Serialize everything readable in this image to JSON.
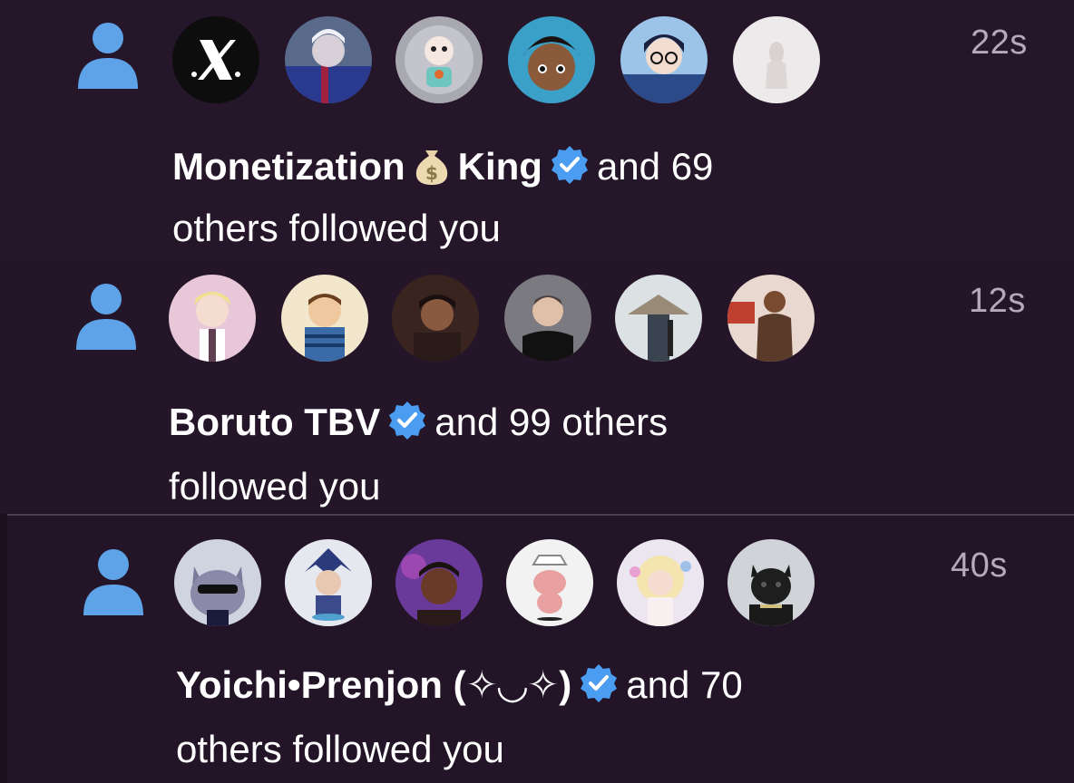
{
  "notifications": [
    {
      "timestamp": "22s",
      "name_part1": "Monetization",
      "name_emoji": "money-bag",
      "name_part2": "King",
      "rest_line1": "and 69",
      "line2": "others followed you",
      "avatars": [
        "x-logo-avatar",
        "football-player-avatar",
        "cartoon-coin-avatar",
        "curly-hair-boy-avatar",
        "anime-glasses-avatar",
        "white-figure-avatar"
      ]
    },
    {
      "timestamp": "12s",
      "name": "Boruto TBV",
      "rest_line1": "and 99 others",
      "line2": "followed you",
      "avatars": [
        "anime-blonde-avatar",
        "cartoon-kid-avatar",
        "dark-portrait-avatar",
        "man-black-shirt-avatar",
        "straw-hat-warrior-avatar",
        "muscular-man-avatar"
      ]
    },
    {
      "timestamp": "40s",
      "name": "Yoichi•Prenjon (✧◡✧)",
      "rest_line1": "and 70",
      "line2": "others followed you",
      "avatars": [
        "sunglasses-cat-avatar",
        "chibi-warrior-avatar",
        "beanie-man-avatar",
        "pink-creature-avatar",
        "blonde-doll-avatar",
        "black-panther-avatar"
      ]
    }
  ],
  "colors": {
    "background": "#241628",
    "person_icon": "#5ea3e8",
    "verified": "#4a9df0",
    "timestamp": "#b6a9bd"
  }
}
